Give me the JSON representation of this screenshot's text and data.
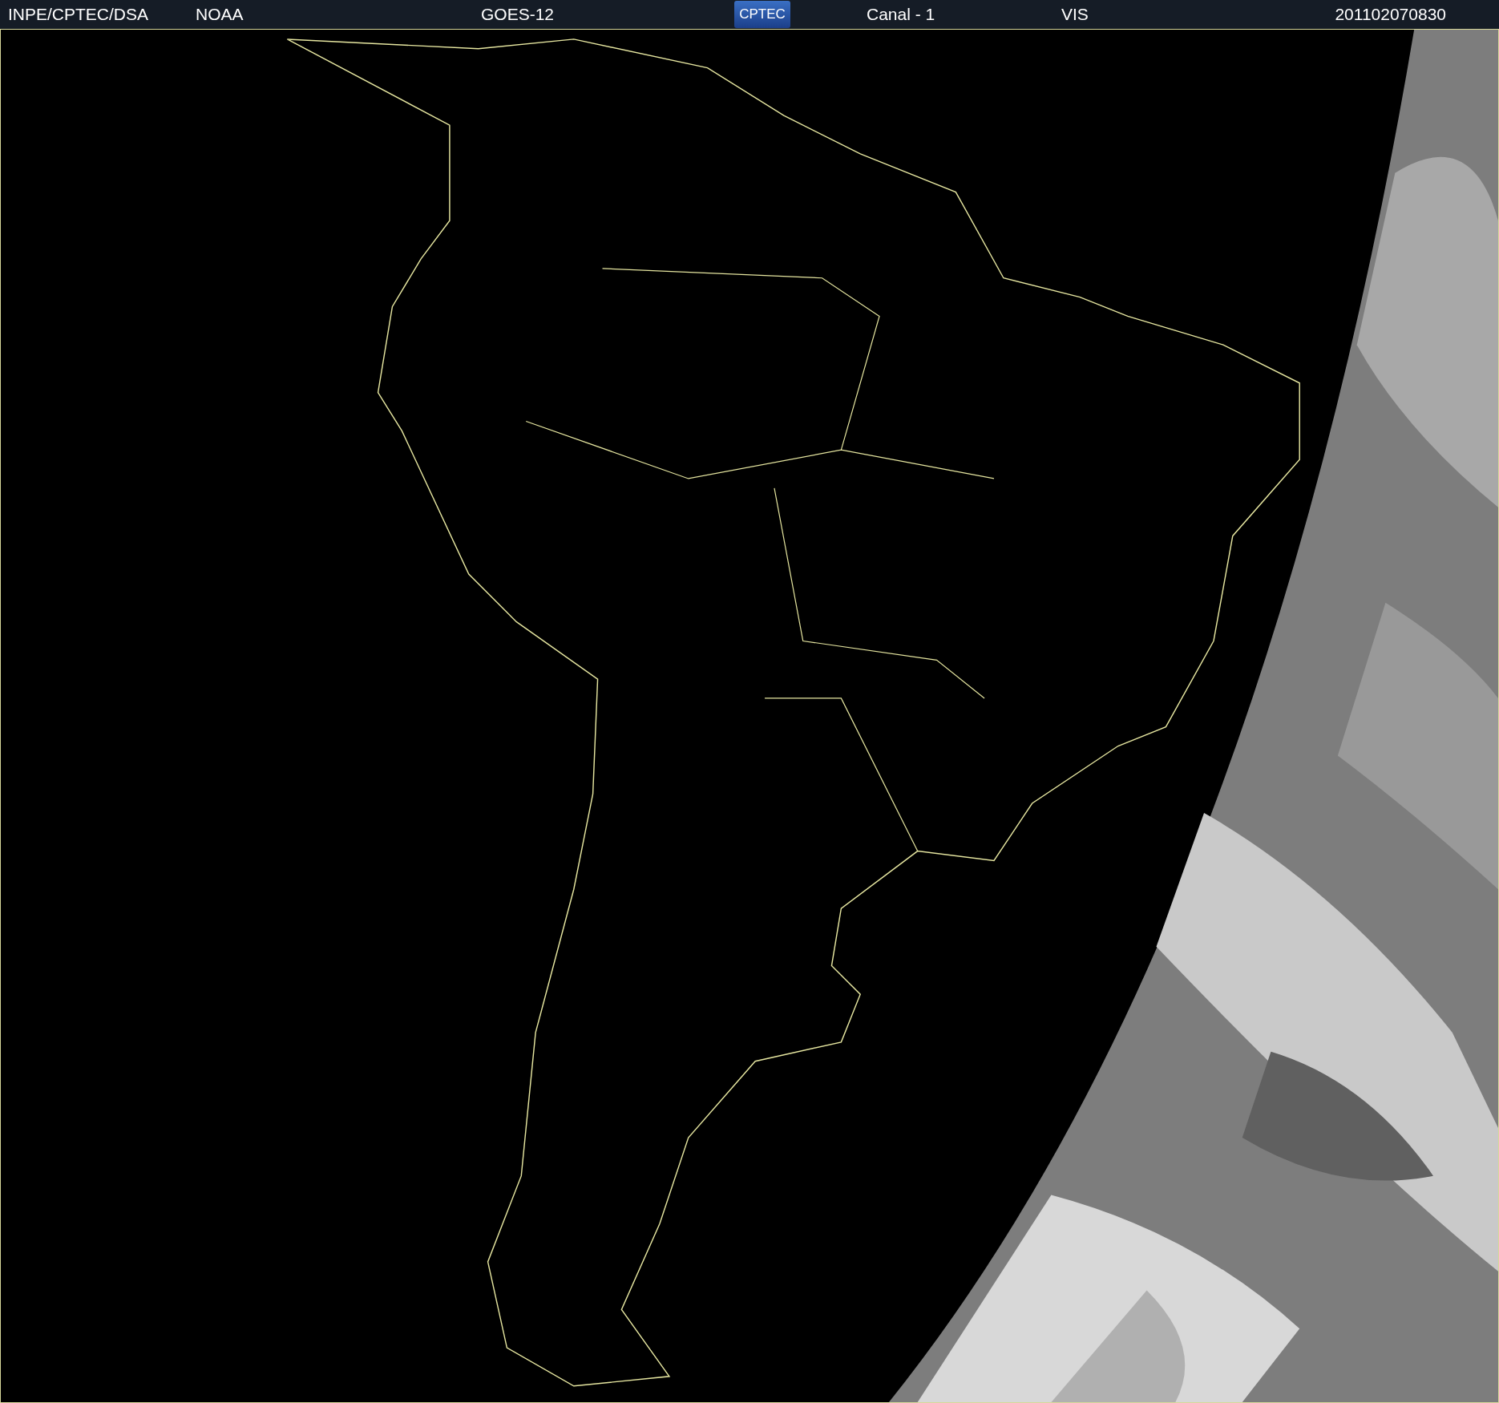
{
  "header": {
    "agency": "INPE/CPTEC/DSA",
    "source": "NOAA",
    "satellite": "GOES-12",
    "logo": "CPTEC",
    "channel": "Canal - 1",
    "band": "VIS",
    "timestamp": "201102070830"
  }
}
